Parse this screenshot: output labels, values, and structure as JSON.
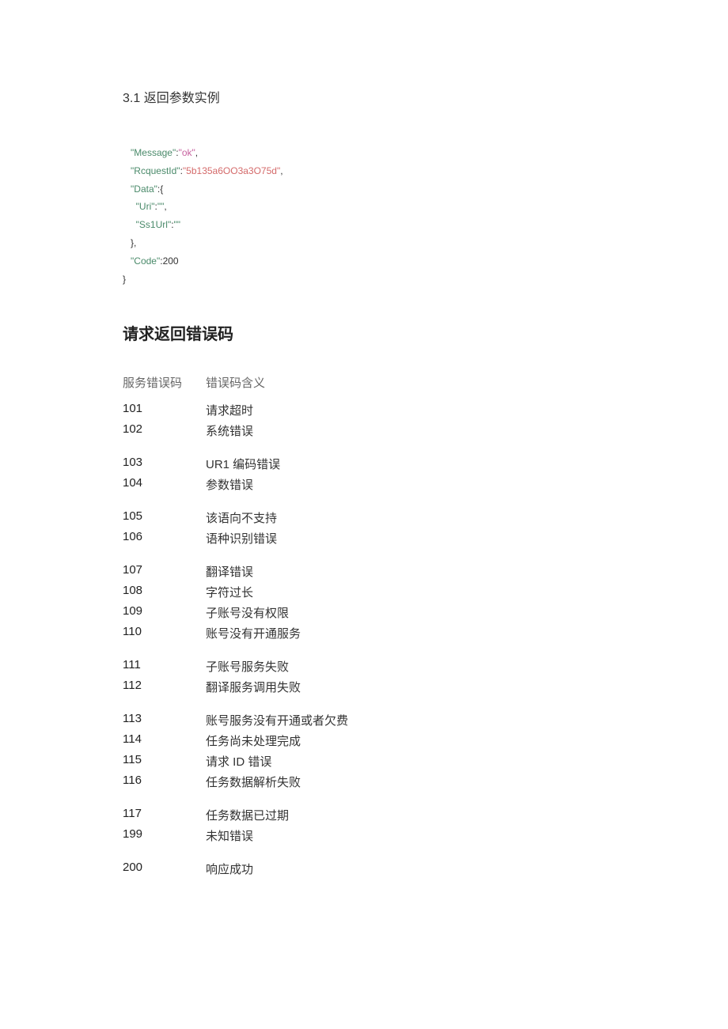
{
  "section_title": "3.1 返回参数实例",
  "code": {
    "line1_key": "\"Message\"",
    "line1_val": "\"ok\"",
    "line2_key": "\"RcquestId\"",
    "line2_val": "\"5b135a6OO3a3O75d\"",
    "line3_key": "\"Data\"",
    "line4_key": "\"Uri\"",
    "line4_val": "\"\"",
    "line5_key": "\"Ss1Url\"",
    "line5_val": "\"\"",
    "line7_key": "\"Code\"",
    "line7_val": "200"
  },
  "error_section_title": "请求返回错误码",
  "error_header_code": "服务错误码",
  "error_header_meaning": "错误码含义",
  "errors": [
    [
      {
        "code": "101",
        "meaning": "请求超时"
      },
      {
        "code": "102",
        "meaning": "系统错误"
      }
    ],
    [
      {
        "code": "103",
        "meaning": "UR1 编码错误"
      },
      {
        "code": "104",
        "meaning": "参数错误"
      }
    ],
    [
      {
        "code": "105",
        "meaning": "该语向不支持"
      },
      {
        "code": "106",
        "meaning": "语种识别错误"
      }
    ],
    [
      {
        "code": "107",
        "meaning": "翻译错误"
      },
      {
        "code": "108",
        "meaning": "字符过长"
      },
      {
        "code": "109",
        "meaning": "子账号没有权限"
      },
      {
        "code": "110",
        "meaning": "账号没有开通服务"
      }
    ],
    [
      {
        "code": "111",
        "meaning": "子账号服务失败"
      },
      {
        "code": "112",
        "meaning": "翻译服务调用失败"
      }
    ],
    [
      {
        "code": "113",
        "meaning": "账号服务没有开通或者欠费"
      },
      {
        "code": "114",
        "meaning": "任务尚未处理完成"
      },
      {
        "code": "115",
        "meaning": "请求 ID 错误"
      },
      {
        "code": "116",
        "meaning": "任务数据解析失败"
      }
    ],
    [
      {
        "code": "117",
        "meaning": "任务数据已过期"
      },
      {
        "code": "199",
        "meaning": "未知错误"
      }
    ],
    [
      {
        "code": "200",
        "meaning": "响应成功"
      }
    ]
  ]
}
